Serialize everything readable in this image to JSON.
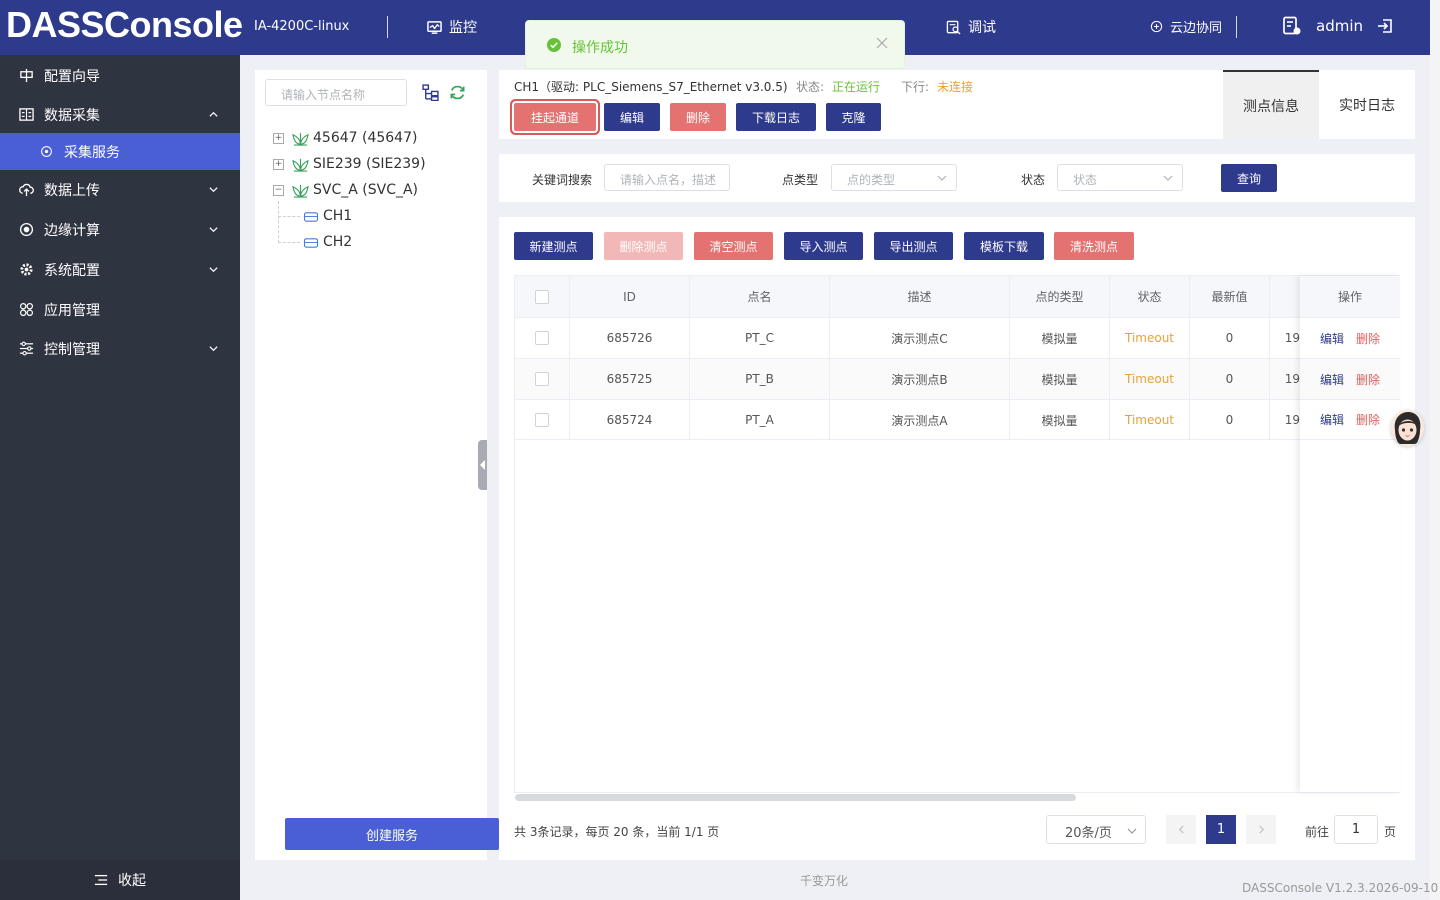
{
  "header": {
    "brand": "DASSConsole",
    "device": "IA-4200C-linux",
    "nav": {
      "monitor": "监控",
      "debug": "调试",
      "cloud": "云边协同"
    },
    "user": "admin"
  },
  "toast": {
    "message": "操作成功"
  },
  "sidebar": {
    "items": [
      {
        "label": "配置向导",
        "icon": "guide-icon"
      },
      {
        "label": "数据采集",
        "icon": "data-collect-icon"
      },
      {
        "label": "采集服务",
        "icon": "service-icon"
      },
      {
        "label": "数据上传",
        "icon": "upload-icon"
      },
      {
        "label": "边缘计算",
        "icon": "edge-compute-icon"
      },
      {
        "label": "系统配置",
        "icon": "settings-icon"
      },
      {
        "label": "应用管理",
        "icon": "apps-icon"
      },
      {
        "label": "控制管理",
        "icon": "control-icon"
      }
    ],
    "collapse": "收起"
  },
  "tree": {
    "search_placeholder": "请输入节点名称",
    "nodes": [
      "45647 (45647)",
      "SIE239 (SIE239)",
      "SVC_A (SVC_A)"
    ],
    "children": [
      "CH1",
      "CH2"
    ],
    "create": "创建服务"
  },
  "channel": {
    "title": "CH1（驱动: PLC_Siemens_S7_Ethernet v3.0.5)",
    "status_label": "状态:",
    "status_value": "正在运行",
    "downlink_label": "下行:",
    "downlink_value": "未连接",
    "buttons": {
      "suspend": "挂起通道",
      "edit": "编辑",
      "delete": "删除",
      "download_log": "下载日志",
      "clone": "克隆"
    },
    "tabs": {
      "points": "测点信息",
      "log": "实时日志"
    }
  },
  "filters": {
    "keyword_label": "关键词搜索",
    "keyword_placeholder": "请输入点名，描述",
    "type_label": "点类型",
    "type_placeholder": "点的类型",
    "status_label": "状态",
    "status_placeholder": "状态",
    "query": "查询"
  },
  "actions": {
    "new": "新建测点",
    "delete": "删除测点",
    "clear": "清空测点",
    "import": "导入测点",
    "export": "导出测点",
    "template": "模板下载",
    "wash": "清洗测点"
  },
  "table": {
    "headers": {
      "id": "ID",
      "name": "点名",
      "desc": "描述",
      "type": "点的类型",
      "status": "状态",
      "latest": "最新值",
      "op": "操作"
    },
    "rows": [
      {
        "id": "685726",
        "name": "PT_C",
        "desc": "演示测点C",
        "type": "模拟量",
        "status": "Timeout",
        "latest": "0",
        "extra": "19"
      },
      {
        "id": "685725",
        "name": "PT_B",
        "desc": "演示测点B",
        "type": "模拟量",
        "status": "Timeout",
        "latest": "0",
        "extra": "19"
      },
      {
        "id": "685724",
        "name": "PT_A",
        "desc": "演示测点A",
        "type": "模拟量",
        "status": "Timeout",
        "latest": "0",
        "extra": "19"
      }
    ],
    "op_edit": "编辑",
    "op_delete": "删除"
  },
  "pager": {
    "info": "共 3条记录，每页 20 条，当前 1/1 页",
    "size": "20条/页",
    "current": "1",
    "goto_label": "前往",
    "goto_value": "1",
    "page_unit": "页"
  },
  "footer": {
    "slogan": "千变万化",
    "version": "DASSConsole V1.2.3.2026-09-10"
  },
  "colors": {
    "navy": "#2e3a8c",
    "sidebar": "#2f3441",
    "active": "#4a5fd6",
    "danger": "#e37270",
    "running": "#67c23a",
    "warning": "#e6a23c"
  }
}
